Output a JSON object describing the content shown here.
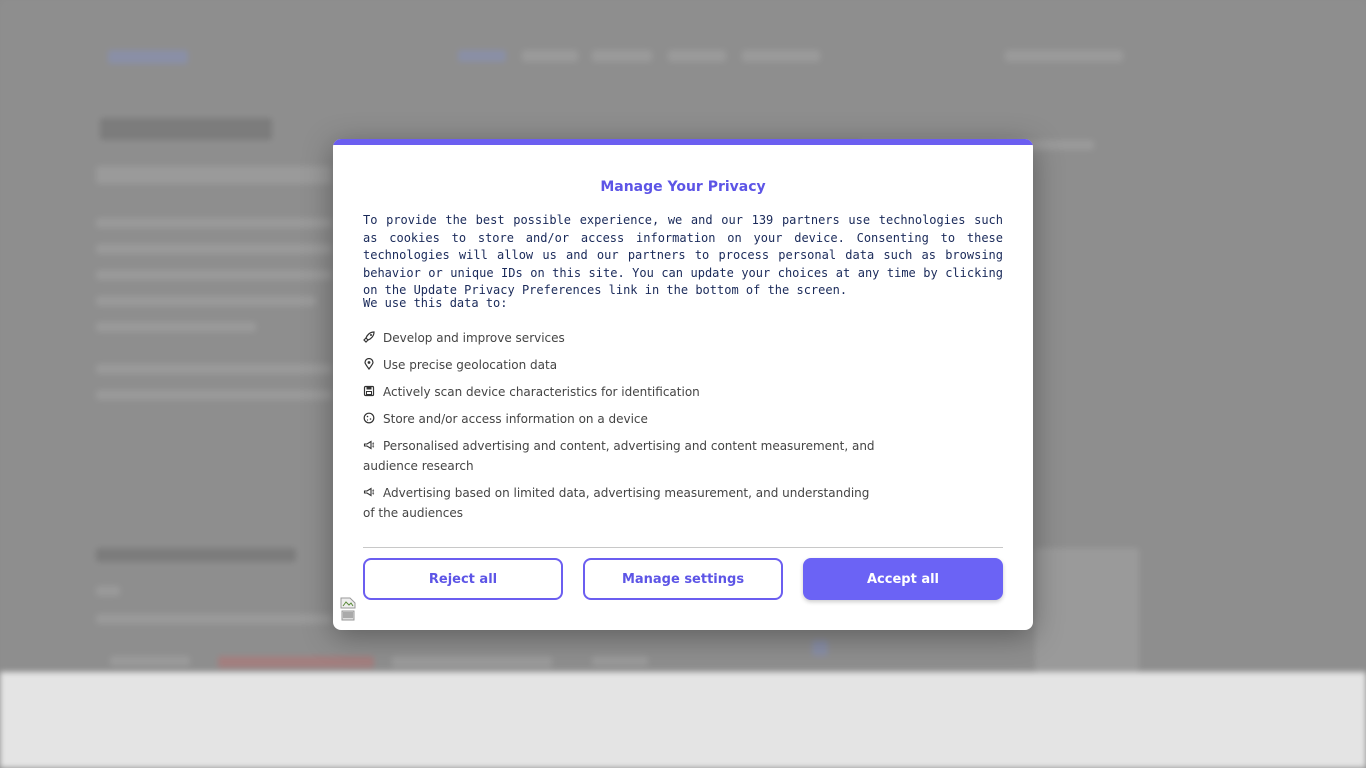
{
  "modal": {
    "title": "Manage Your Privacy",
    "intro": "To provide the best possible experience, we and our 139 partners use technologies such as cookies to store and/or access information on your device. Consenting to these technologies will allow us and our partners to process personal data such as browsing behavior or unique IDs on this site. You can update your choices at any time by clicking on the Update Privacy Preferences link in the bottom of the screen.",
    "use_label": "We use this data to:",
    "purposes": [
      {
        "icon": "rocket-icon",
        "label": "Develop and improve services"
      },
      {
        "icon": "location-pin-icon",
        "label": "Use precise geolocation data"
      },
      {
        "icon": "save-disk-icon",
        "label": "Actively scan device characteristics for identification"
      },
      {
        "icon": "cookie-icon",
        "label": "Store and/or access information on a device"
      },
      {
        "icon": "megaphone-icon",
        "label": "Personalised advertising and content, advertising and content measurement, and audience research"
      },
      {
        "icon": "megaphone-icon",
        "label": "Advertising based on limited data, advertising measurement, and understanding of the audiences"
      }
    ],
    "buttons": {
      "reject": "Reject all",
      "manage": "Manage settings",
      "accept": "Accept all"
    }
  },
  "colors": {
    "accent": "#6b5ef0",
    "overlay": "#8c8c8c",
    "text_dark": "#1a2a5a"
  }
}
